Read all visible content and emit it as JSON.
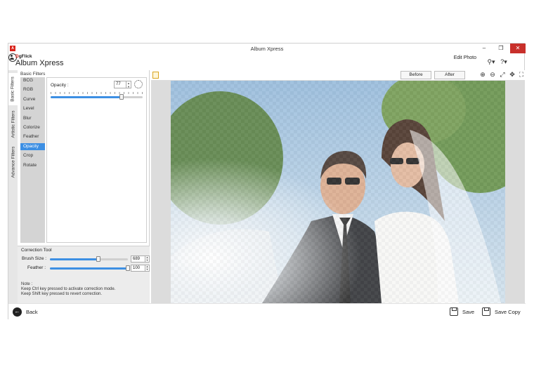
{
  "window": {
    "title": "Album Xpress",
    "controls": [
      "–",
      "❐",
      "✕"
    ]
  },
  "header": {
    "brand": "DgFlick",
    "app_name": "Album Xpress",
    "mode_label": "Edit Photo"
  },
  "side_tabs": [
    "Basic Filters",
    "Artistic Filters",
    "Advance Filters"
  ],
  "filters_panel": {
    "title": "Basic Filters",
    "items": [
      "BCG",
      "RGB",
      "Curve",
      "Level",
      "Blur",
      "Colorize",
      "Feather",
      "Opacity",
      "Crop",
      "Rotate"
    ],
    "selected": "Opacity"
  },
  "opacity": {
    "label": "Opacity :",
    "value": "77",
    "fraction": 0.77
  },
  "correction_tool": {
    "title": "Correction Tool",
    "brush_label": "Brush Size :",
    "brush_value": "689",
    "brush_fraction": 0.62,
    "feather_label": "Feather :",
    "feather_value": "100",
    "feather_fraction": 1.0,
    "note_title": "Note :",
    "note_line1": "Keep Ctrl key pressed to activate correction mode.",
    "note_line2": "Keep Shift key pressed to revert correction."
  },
  "canvas_toolbar": {
    "before_label": "Before",
    "after_label": "After"
  },
  "footer": {
    "back_label": "Back",
    "save_label": "Save",
    "save_copy_label": "Save Copy"
  },
  "colors": {
    "accent": "#3d8fe3",
    "close": "#c8302b",
    "brand_red": "#d9251d"
  }
}
